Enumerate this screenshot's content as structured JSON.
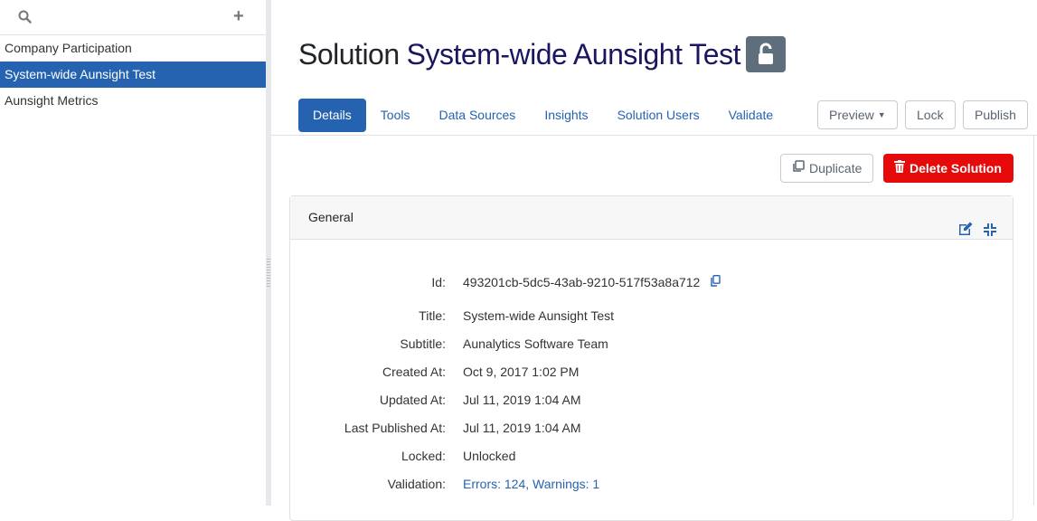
{
  "sidebar": {
    "items": [
      {
        "label": "Company Participation"
      },
      {
        "label": "System-wide Aunsight Test"
      },
      {
        "label": "Aunsight Metrics"
      }
    ],
    "search_icon": "search-icon",
    "add_icon": "plus-icon"
  },
  "header": {
    "prefix": "Solution",
    "name": "System-wide Aunsight Test",
    "lock_icon": "unlock-icon"
  },
  "tabs": [
    {
      "label": "Details"
    },
    {
      "label": "Tools"
    },
    {
      "label": "Data Sources"
    },
    {
      "label": "Insights"
    },
    {
      "label": "Solution Users"
    },
    {
      "label": "Validate"
    }
  ],
  "actions": {
    "preview": "Preview",
    "lock": "Lock",
    "publish": "Publish",
    "duplicate": "Duplicate",
    "delete": "Delete Solution"
  },
  "colors": {
    "accent": "#2563b0",
    "danger": "#e60a0a",
    "title": "#1a1760"
  },
  "card": {
    "title": "General",
    "fields": [
      {
        "label": "Id:",
        "value": "493201cb-5dc5-43ab-9210-517f53a8a712"
      },
      {
        "label": "Title:",
        "value": "System-wide Aunsight Test"
      },
      {
        "label": "Subtitle:",
        "value": "Aunalytics Software Team"
      },
      {
        "label": "Created At:",
        "value": "Oct 9, 2017 1:02 PM"
      },
      {
        "label": "Updated At:",
        "value": "Jul 11, 2019 1:04 AM"
      },
      {
        "label": "Last Published At:",
        "value": "Jul 11, 2019 1:04 AM"
      },
      {
        "label": "Locked:",
        "value": "Unlocked"
      },
      {
        "label": "Validation:",
        "value": "Errors: 124, Warnings: 1"
      }
    ]
  }
}
